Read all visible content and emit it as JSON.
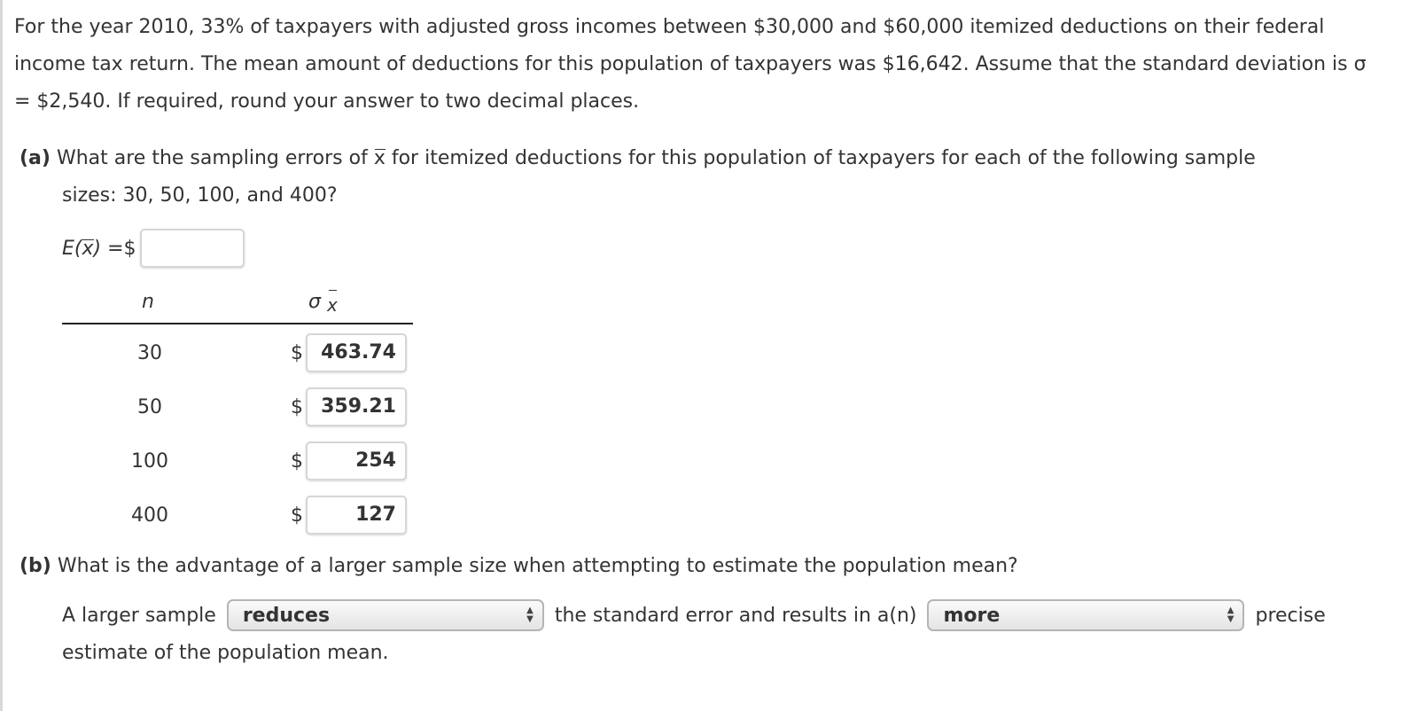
{
  "intro": "For the year 2010, 33% of taxpayers with adjusted gross incomes between $30,000 and $60,000 itemized deductions on their federal income tax return. The mean amount of deductions for this population of taxpayers was $16,642. Assume that the standard deviation is σ = $2,540. If required, round your answer to two decimal places.",
  "part_a": {
    "label": "(a)",
    "question_line1": " What are the sampling errors of ",
    "question_xbar": "x",
    "question_line1_end": " for itemized deductions for this population of taxpayers for each of the following sample",
    "question_line2": "sizes: 30, 50, 100, and 400?",
    "ex_label_pre": "E(",
    "ex_label_x": "x",
    "ex_label_post": ") = ",
    "ex_currency": "$",
    "ex_value": "",
    "table": {
      "col_n": "n",
      "col_sigma": "σ",
      "col_sigma_sub": "x",
      "currency": "$",
      "rows": [
        {
          "n": "30",
          "value": "463.74"
        },
        {
          "n": "50",
          "value": "359.21"
        },
        {
          "n": "100",
          "value": "254"
        },
        {
          "n": "400",
          "value": "127"
        }
      ]
    }
  },
  "part_b": {
    "label": "(b)",
    "question": " What is the advantage of a larger sample size when attempting to estimate the population mean?",
    "sentence_start": "A larger sample",
    "select1_value": "reduces",
    "sentence_mid": "the standard error and results in a(n)",
    "select2_value": "more",
    "sentence_end": "precise",
    "sentence_line2": "estimate of the population mean."
  }
}
